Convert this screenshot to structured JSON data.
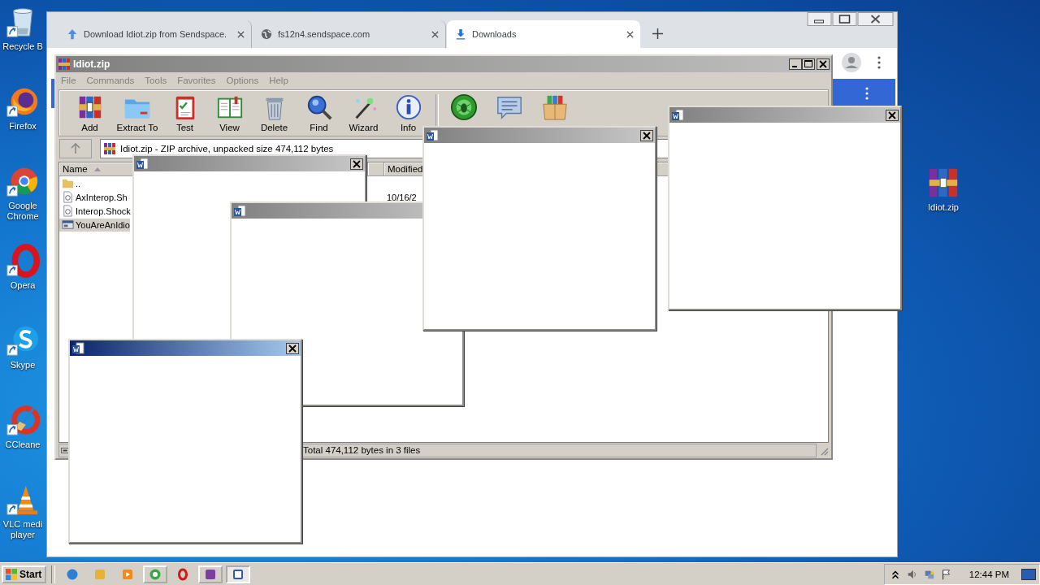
{
  "desktop_icons": [
    {
      "label": "Recycle B"
    },
    {
      "label": "Firefox"
    },
    {
      "label": "Google Chrome"
    },
    {
      "label": "Opera"
    },
    {
      "label": "Skype"
    },
    {
      "label": "CCleane"
    },
    {
      "label": "VLC medi player"
    }
  ],
  "desktop_file": {
    "label": "Idiot.zip"
  },
  "browser": {
    "tabs": [
      {
        "title": "Download Idiot.zip from Sendspace.",
        "selected": false
      },
      {
        "title": "fs12n4.sendspace.com",
        "selected": false
      },
      {
        "title": "Downloads",
        "selected": true
      }
    ]
  },
  "archiver": {
    "title": "Idiot.zip",
    "menu": [
      "File",
      "Commands",
      "Tools",
      "Favorites",
      "Options",
      "Help"
    ],
    "toolbar": [
      "Add",
      "Extract To",
      "Test",
      "View",
      "Delete",
      "Find",
      "Wizard",
      "Info"
    ],
    "path": "Idiot.zip - ZIP archive, unpacked size 474,112 bytes",
    "columns": [
      "Name",
      "Modified"
    ],
    "rows": [
      {
        "name": "..",
        "selected": false
      },
      {
        "name": "AxInterop.Sh",
        "modified": "10/16/2",
        "selected": false
      },
      {
        "name": "Interop.Shock",
        "selected": false
      },
      {
        "name": "YouAreAnIdio",
        "selected": true
      }
    ],
    "status": "Total 474,112 bytes in 3 files"
  },
  "popups": [
    {
      "active": false
    },
    {
      "active": false
    },
    {
      "active": false
    },
    {
      "active": false
    },
    {
      "active": true
    }
  ],
  "taskbar": {
    "start": "Start",
    "buttons": [
      {
        "running": false,
        "selected": false
      },
      {
        "running": false,
        "selected": false
      },
      {
        "running": false,
        "selected": false
      },
      {
        "running": true,
        "selected": false
      },
      {
        "running": false,
        "selected": false
      },
      {
        "running": true,
        "selected": false
      },
      {
        "running": true,
        "selected": true
      }
    ],
    "clock": "12:44 PM"
  }
}
